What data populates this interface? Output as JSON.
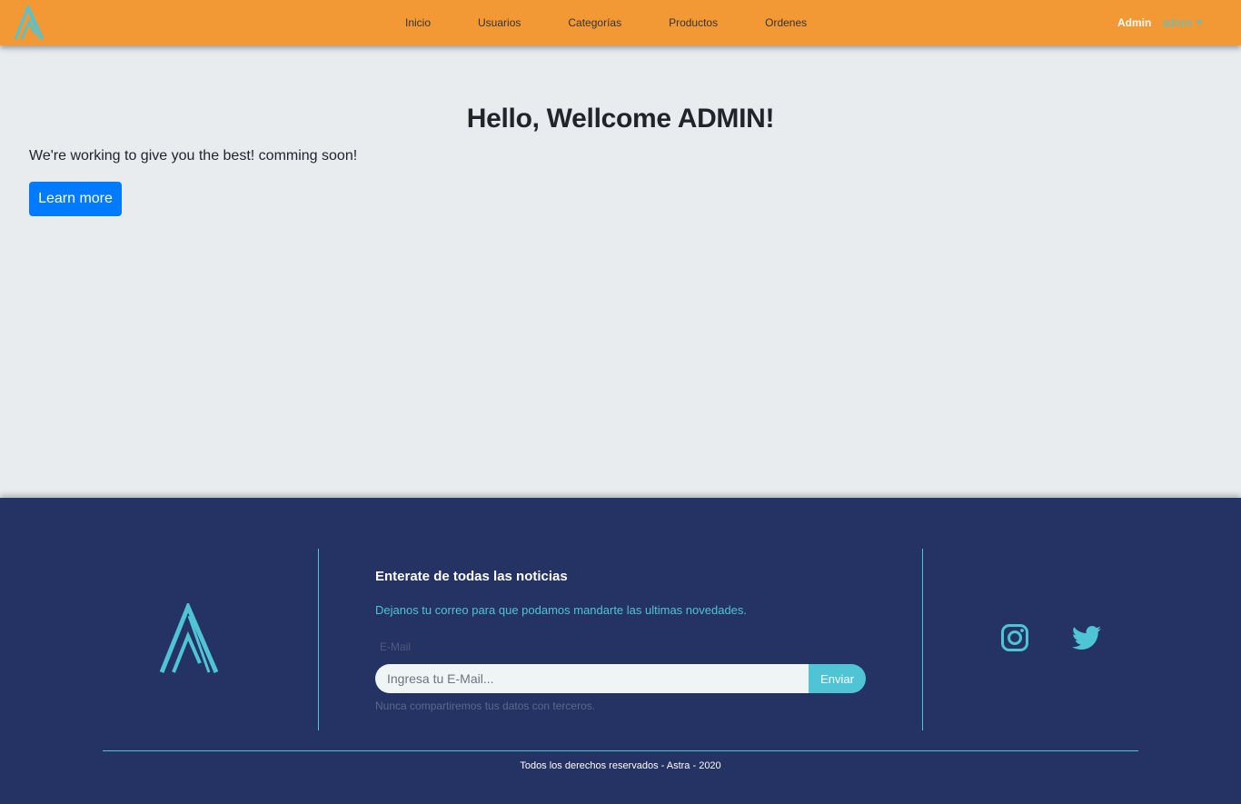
{
  "navbar": {
    "brand_name": "Astra logo",
    "links": [
      "Inicio",
      "Usuarios",
      "Categorías",
      "Productos",
      "Ordenes"
    ],
    "user_role": "Admin",
    "user_name": "admin",
    "background_color": "#f29935",
    "accent_color": "#4fc4d4"
  },
  "hero": {
    "title": "Hello, Wellcome ADMIN!",
    "text": "We're working to give you the best! comming soon!",
    "button_label": "Learn more",
    "button_color": "#007bff"
  },
  "footer": {
    "background_color": "#243264",
    "newsletter_title": "Enterate de todas las noticias",
    "newsletter_subtitle": "Dejanos tu correo para que podamos mandarte las ultimas novedades.",
    "email_label": "E-Mail",
    "email_placeholder": "Ingresa tu E-Mail...",
    "email_value": "",
    "send_label": "Enviar",
    "email_help": "Nunca compartiremos tus datos con terceros.",
    "social_icons": [
      "instagram-icon",
      "twitter-icon"
    ],
    "copyright": "Todos los derechos reservados - Astra - 2020"
  }
}
